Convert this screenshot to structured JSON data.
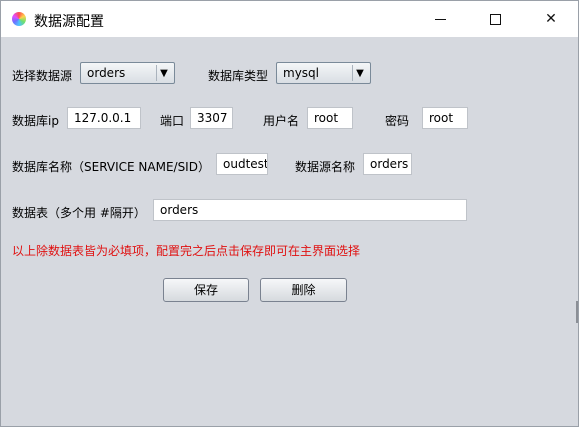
{
  "window": {
    "title": "数据源配置",
    "minimize": "—",
    "maximize": "☐",
    "close": "✕"
  },
  "form": {
    "source_select_label": "选择数据源",
    "source_select_value": "orders",
    "db_type_label": "数据库类型",
    "db_type_value": "mysql",
    "db_ip_label": "数据库ip",
    "db_ip_value": "127.0.0.1",
    "port_label": "端口",
    "port_value": "3307",
    "username_label": "用户名",
    "username_value": "root",
    "password_label": "密码",
    "password_value": "root",
    "db_name_label": "数据库名称（SERVICE NAME/SID）",
    "db_name_value": "oudtest",
    "source_name_label": "数据源名称",
    "source_name_value": "orders",
    "tables_label": "数据表（多个用 #隔开）",
    "tables_value": "orders"
  },
  "hint": "以上除数据表皆为必填项，配置完之后点击保存即可在主界面选择",
  "buttons": {
    "save": "保存",
    "delete": "删除"
  },
  "icons": {
    "app": "color-wheel-icon",
    "dropdown": "dropdown-arrow-icon"
  },
  "colors": {
    "hint_text": "#e01111",
    "background": "#d6d9df"
  }
}
